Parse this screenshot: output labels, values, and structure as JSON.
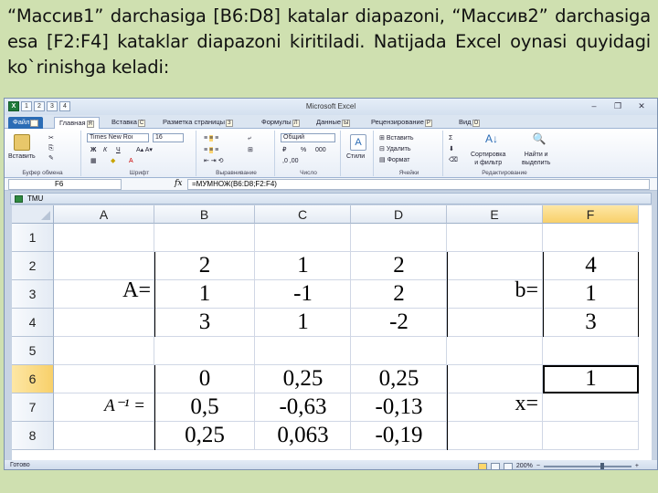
{
  "caption": "“Массив1”  darchasiga [B6:D8] katalar diapazoni,  “Массив2” darchasiga esa [F2:F4] kataklar diapazoni kiritiladi. Natijada Excel oynasi quyidagi ko`rinishga keladi:",
  "window": {
    "title": "Microsoft Excel",
    "logo": "X",
    "qa": [
      "1",
      "2",
      "3",
      "4"
    ]
  },
  "tabs": [
    {
      "label": "Файл",
      "key": "Ф"
    },
    {
      "label": "Главная",
      "key": "Я"
    },
    {
      "label": "Вставка",
      "key": "С"
    },
    {
      "label": "Разметка страницы",
      "key": "З"
    },
    {
      "label": "Формулы",
      "key": "Л"
    },
    {
      "label": "Данные",
      "key": "Ы"
    },
    {
      "label": "Рецензирование",
      "key": "Р"
    },
    {
      "label": "Вид",
      "key": "О"
    }
  ],
  "ribbon": {
    "paste": "Вставить",
    "clipboard": "Буфер обмена",
    "font_name": "Times New Roı",
    "font_size": "16",
    "bold": "Ж",
    "italic": "К",
    "underline": "Ч",
    "font_group": "Шрифт",
    "align_group": "Выравнивание",
    "number_format": "Общий",
    "percent": "%",
    "thousands": "000",
    "number_group": "Число",
    "styles": "Стили",
    "insert": "Вставить",
    "delete": "Удалить",
    "format": "Формат",
    "cells_group": "Ячейки",
    "sum": "Σ",
    "sort": "Сортировка\nи фильтр",
    "find": "Найти и\nвыделить",
    "edit_group": "Редактирование"
  },
  "formula_bar": {
    "name_box": "F6",
    "fx": "fx",
    "formula": "=МУМНОЖ(B6:D8;F2:F4)"
  },
  "workbook": {
    "title": "TMU"
  },
  "columns": [
    "A",
    "B",
    "C",
    "D",
    "E",
    "F"
  ],
  "rows": [
    "1",
    "2",
    "3",
    "4",
    "5",
    "6",
    "7",
    "8"
  ],
  "selected_cell": {
    "col": "F",
    "row": "6"
  },
  "labels": {
    "A": "A=",
    "b": "b=",
    "Ainv": "A⁻¹ =",
    "x": "x="
  },
  "matrix_A": [
    [
      "2",
      "1",
      "2"
    ],
    [
      "1",
      "-1",
      "2"
    ],
    [
      "3",
      "1",
      "-2"
    ]
  ],
  "vector_b": [
    "4",
    "1",
    "3"
  ],
  "matrix_Ainv": [
    [
      "0",
      "0,25",
      "0,25"
    ],
    [
      "0,5",
      "-0,63",
      "-0,13"
    ],
    [
      "0,25",
      "0,063",
      "-0,19"
    ]
  ],
  "vector_x": [
    "1",
    "",
    ""
  ],
  "status": {
    "ready": "Готово",
    "zoom": "200%",
    "minus": "−",
    "plus": "+"
  }
}
